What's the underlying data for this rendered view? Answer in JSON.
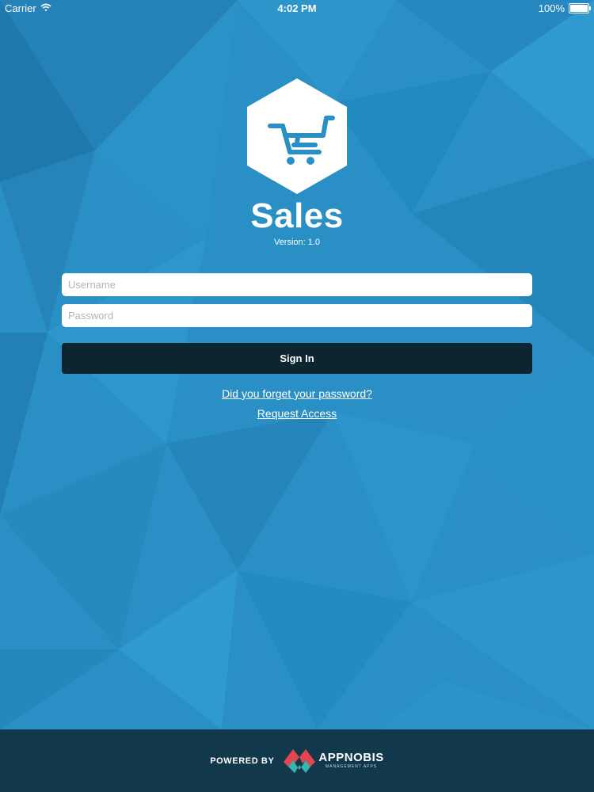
{
  "status_bar": {
    "carrier": "Carrier",
    "time": "4:02 PM",
    "battery": "100%"
  },
  "app": {
    "title": "Sales",
    "version": "Version: 1.0"
  },
  "form": {
    "username_placeholder": "Username",
    "password_placeholder": "Password",
    "signin_label": "Sign In",
    "forgot_link": "Did you forget your password?",
    "request_link": "Request Access"
  },
  "footer": {
    "powered_by": "POWERED BY",
    "brand": "APPNOBIS",
    "tagline": "MANAGEMENT APPS"
  },
  "colors": {
    "background": "#2a8fc4",
    "button": "#0d2431",
    "footer": "#12384c",
    "brand_accent_red": "#e2474f",
    "brand_accent_teal": "#37b6b1"
  }
}
